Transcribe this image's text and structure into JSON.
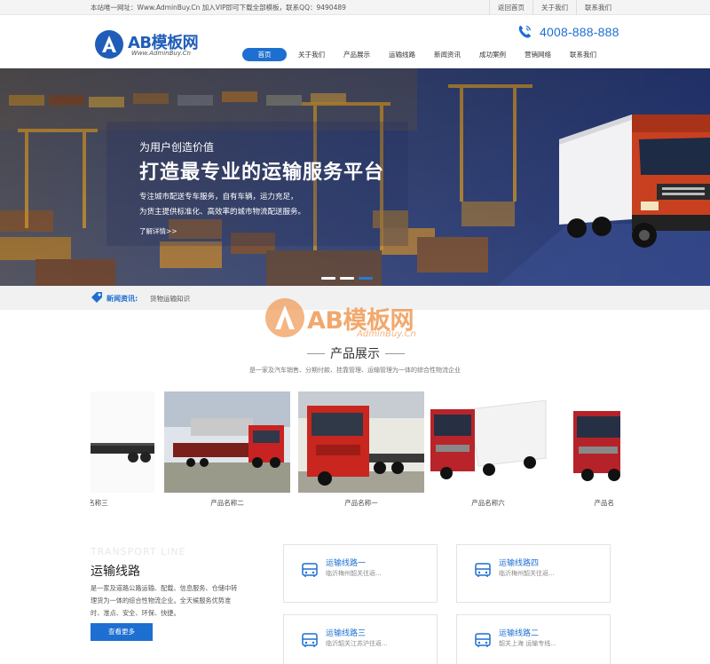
{
  "topbar": {
    "notice": "本站唯一网址：Www.AdminBuy.Cn 加入VIP即可下载全部模板，联系QQ：9490489",
    "links": [
      "返回首页",
      "关于我们",
      "联系我们"
    ]
  },
  "header": {
    "logo_text": "AB模板网",
    "logo_sub": "Www.AdminBuy.Cn",
    "phone": "4008-888-888"
  },
  "nav": {
    "items": [
      "首页",
      "关于我们",
      "产品展示",
      "运输线路",
      "新闻资讯",
      "成功案例",
      "营销网络",
      "联系我们"
    ],
    "active": "首页"
  },
  "banner": {
    "small_title": "为用户创造价值",
    "big_title": "打造最专业的运输服务平台",
    "desc_line1": "专注城市配送专车服务，自有车辆，运力充足，",
    "desc_line2": "为货主提供标准化、高效率的城市物流配送服务。",
    "more": "了解详情>>",
    "slides": 3,
    "active_slide": 3
  },
  "news": {
    "label": "新闻资讯:",
    "item": "货物运输知识"
  },
  "products": {
    "watermark_text": "AB模板网",
    "watermark_sub": "AdminBuy.Cn",
    "title": "产品展示",
    "subtitle": "是一家及汽车销售、分期付款、挂靠管理、运输管理为一体的综合性物流企业",
    "items": [
      {
        "name": "产品名称三"
      },
      {
        "name": "产品名称二"
      },
      {
        "name": "产品名称一"
      },
      {
        "name": "产品名称六"
      },
      {
        "name": "产品名"
      }
    ]
  },
  "transport": {
    "en_title": "TRANSPORT LINE",
    "title": "运输线路",
    "desc": "是一家及道路公路运输、配载、信息服务、仓储中转理货为一体的综合性物流企业。全天候服务优势准时、准点、安全、环保、快捷。",
    "button": "查看更多",
    "routes": [
      {
        "title": "运输线路一",
        "desc": "临沂梅州韶关往返..."
      },
      {
        "title": "运输线路四",
        "desc": "临沂梅州韶关往返..."
      },
      {
        "title": "运输线路三",
        "desc": "临沂韶关江苏沪往返..."
      },
      {
        "title": "运输线路二",
        "desc": "韶关上海 运输专线..."
      }
    ]
  },
  "colors": {
    "accent": "#1d6fd1",
    "topbar_bg": "#f4f4f4",
    "news_bg": "#f1f1f1",
    "watermark": "#f09a54"
  }
}
